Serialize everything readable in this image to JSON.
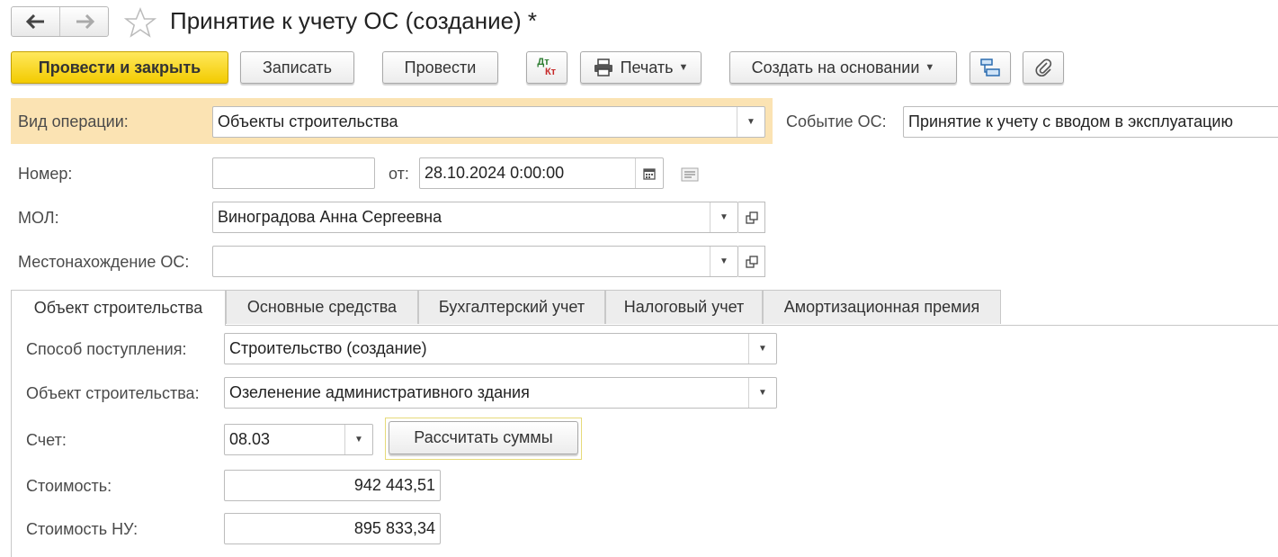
{
  "window": {
    "title": "Принятие к учету ОС (создание) *",
    "nav": {
      "back_icon": "arrow-left-icon",
      "forward_icon": "arrow-right-icon",
      "favorite_icon": "star-icon"
    }
  },
  "toolbar": {
    "post_close": "Провести и закрыть",
    "save": "Записать",
    "post": "Провести",
    "dtkt_top": "Дт",
    "dtkt_bottom": "Кт",
    "print": "Печать",
    "create_based": "Создать на основании",
    "structure_icon": "structure-icon",
    "attach_icon": "paperclip-icon"
  },
  "form": {
    "operation_label": "Вид операции:",
    "operation_value": "Объекты строительства",
    "event_label": "Событие ОС:",
    "event_value": "Принятие к учету с вводом в эксплуатацию",
    "number_label": "Номер:",
    "number_value": "",
    "date_label": "от:",
    "date_value": "28.10.2024  0:00:00",
    "mol_label": "МОЛ:",
    "mol_value": "Виноградова Анна Сергеевна",
    "location_label": "Местонахождение ОС:",
    "location_value": ""
  },
  "tabs": [
    {
      "label": "Объект строительства",
      "active": true
    },
    {
      "label": "Основные средства",
      "active": false
    },
    {
      "label": "Бухгалтерский учет",
      "active": false
    },
    {
      "label": "Налоговый учет",
      "active": false
    },
    {
      "label": "Амортизационная премия",
      "active": false
    }
  ],
  "panel": {
    "method_label": "Способ поступления:",
    "method_value": "Строительство (создание)",
    "object_label": "Объект строительства:",
    "object_value": "Озеленение административного здания",
    "account_label": "Счет:",
    "account_value": "08.03",
    "calc_button": "Рассчитать суммы",
    "cost_label": "Стоимость:",
    "cost_value": "942 443,51",
    "cost_tax_label": "Стоимость НУ:",
    "cost_tax_value": "895 833,34"
  },
  "colors": {
    "primary_button": "#f3cb00",
    "highlight_row": "#fbe3b3",
    "dt": "#2e7d32",
    "kt": "#c62828"
  }
}
